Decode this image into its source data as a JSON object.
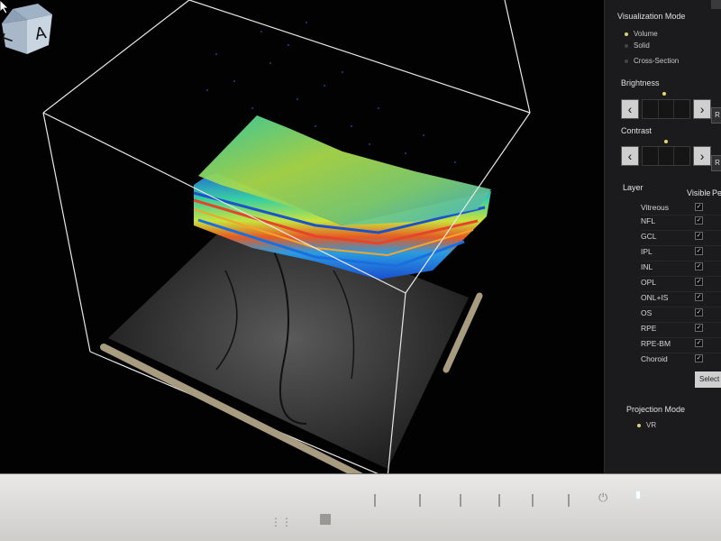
{
  "visualization_mode": {
    "title": "Visualization Mode",
    "options": [
      {
        "label": "Volume",
        "selected": true
      },
      {
        "label": "Solid",
        "selected": false
      },
      {
        "label": "Cross-Section",
        "selected": false
      }
    ]
  },
  "brightness": {
    "title": "Brightness",
    "prev_icon": "chevron-left-icon",
    "next_icon": "chevron-right-icon",
    "reset_label": "R"
  },
  "contrast": {
    "title": "Contrast",
    "prev_icon": "chevron-left-icon",
    "next_icon": "chevron-right-icon",
    "reset_label": "R"
  },
  "layers": {
    "header": {
      "layer": "Layer",
      "visible": "Visible",
      "peel": "Pe"
    },
    "items": [
      {
        "name": "Vitreous",
        "visible": true
      },
      {
        "name": "NFL",
        "visible": true
      },
      {
        "name": "GCL",
        "visible": true
      },
      {
        "name": "IPL",
        "visible": true
      },
      {
        "name": "INL",
        "visible": true
      },
      {
        "name": "OPL",
        "visible": true
      },
      {
        "name": "ONL+IS",
        "visible": true
      },
      {
        "name": "OS",
        "visible": true
      },
      {
        "name": "RPE",
        "visible": true
      },
      {
        "name": "RPE-BM",
        "visible": true
      },
      {
        "name": "Choroid",
        "visible": true
      }
    ],
    "select_label": "Select"
  },
  "projection_mode": {
    "title": "Projection Mode",
    "options": [
      {
        "label": "VR",
        "selected": true
      }
    ]
  },
  "orientation_cube": {
    "front_label": "A",
    "side_label": "T"
  },
  "colors": {
    "panel_bg": "#1b1b1d",
    "accent": "#d8d27a",
    "viewport_bg": "#020202"
  }
}
